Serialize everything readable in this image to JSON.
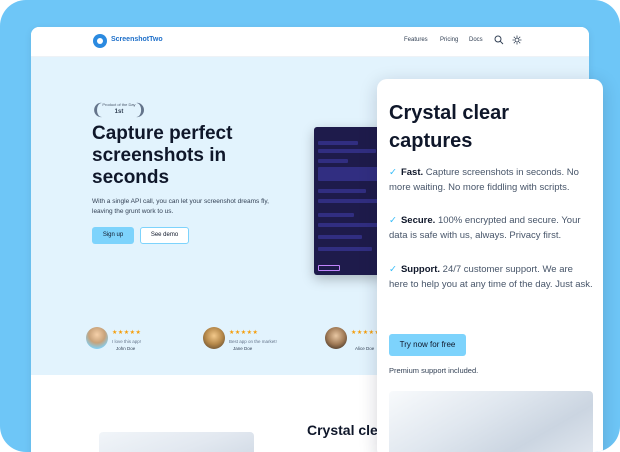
{
  "brand": {
    "name": "ScreenshotTwo",
    "accent": "#7dd3fc",
    "frame_color": "#6ec6f7"
  },
  "nav": {
    "links": [
      "Features",
      "Pricing",
      "Docs"
    ],
    "icons": [
      "search-icon",
      "sun-icon"
    ]
  },
  "hero": {
    "badge_line1": "Product of the Day",
    "badge_line2": "1st",
    "headline": "Capture perfect screenshots in seconds",
    "subtext": "With a single API call, you can let your screenshot dreams fly, leaving the grunt work to us.",
    "primary_button": "Sign up",
    "secondary_button": "See demo"
  },
  "reviews": [
    {
      "stars": "★★★★★",
      "quote": "I love this app!",
      "author": "John Doe"
    },
    {
      "stars": "★★★★★",
      "quote": "Best app on the market!",
      "author": "Jane Doe"
    },
    {
      "stars": "★★★★★",
      "quote": "",
      "author": "Alice Doe"
    }
  ],
  "section2": {
    "title": "Crystal cle"
  },
  "card": {
    "title": "Crystal clear captures",
    "features": [
      {
        "lead": "Fast.",
        "text": "Capture screenshots in seconds. No more waiting. No more fiddling with scripts."
      },
      {
        "lead": "Secure.",
        "text": "100% encrypted and secure. Your data is safe with us, always. Privacy first."
      },
      {
        "lead": "Support.",
        "text": "24/7 customer support. We are here to help you at any time of the day. Just ask."
      }
    ],
    "button": "Try now for free",
    "note": "Premium support included."
  }
}
